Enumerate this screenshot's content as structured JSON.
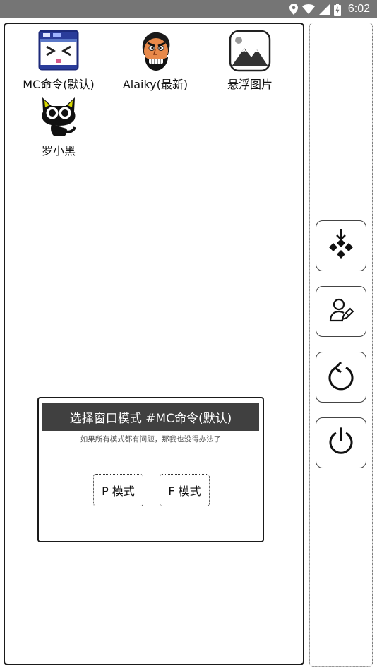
{
  "status_bar": {
    "time": "6:02",
    "icons": [
      "location-icon",
      "wifi-icon",
      "signal-icon",
      "battery-charging-icon"
    ]
  },
  "apps": [
    {
      "label": "MC命令(默认)",
      "icon": "mc-command-icon"
    },
    {
      "label": "Alaiky(最新)",
      "icon": "alaiky-avatar-icon"
    },
    {
      "label": "悬浮图片",
      "icon": "floating-image-icon"
    },
    {
      "label": "罗小黑",
      "icon": "black-cat-icon"
    }
  ],
  "side_buttons": [
    {
      "icon": "gamepad-icon"
    },
    {
      "icon": "user-edit-icon"
    },
    {
      "icon": "refresh-icon"
    },
    {
      "icon": "power-icon"
    }
  ],
  "dialog": {
    "title": "选择窗口模式 #MC命令(默认)",
    "subtitle": "如果所有模式都有问题，那我也没得办法了",
    "buttons": [
      {
        "label": "P 模式"
      },
      {
        "label": "F 模式"
      }
    ]
  },
  "colors": {
    "status_bar": "#757575",
    "dialog_title_bg": "#404040",
    "border": "#1a1a1a"
  }
}
